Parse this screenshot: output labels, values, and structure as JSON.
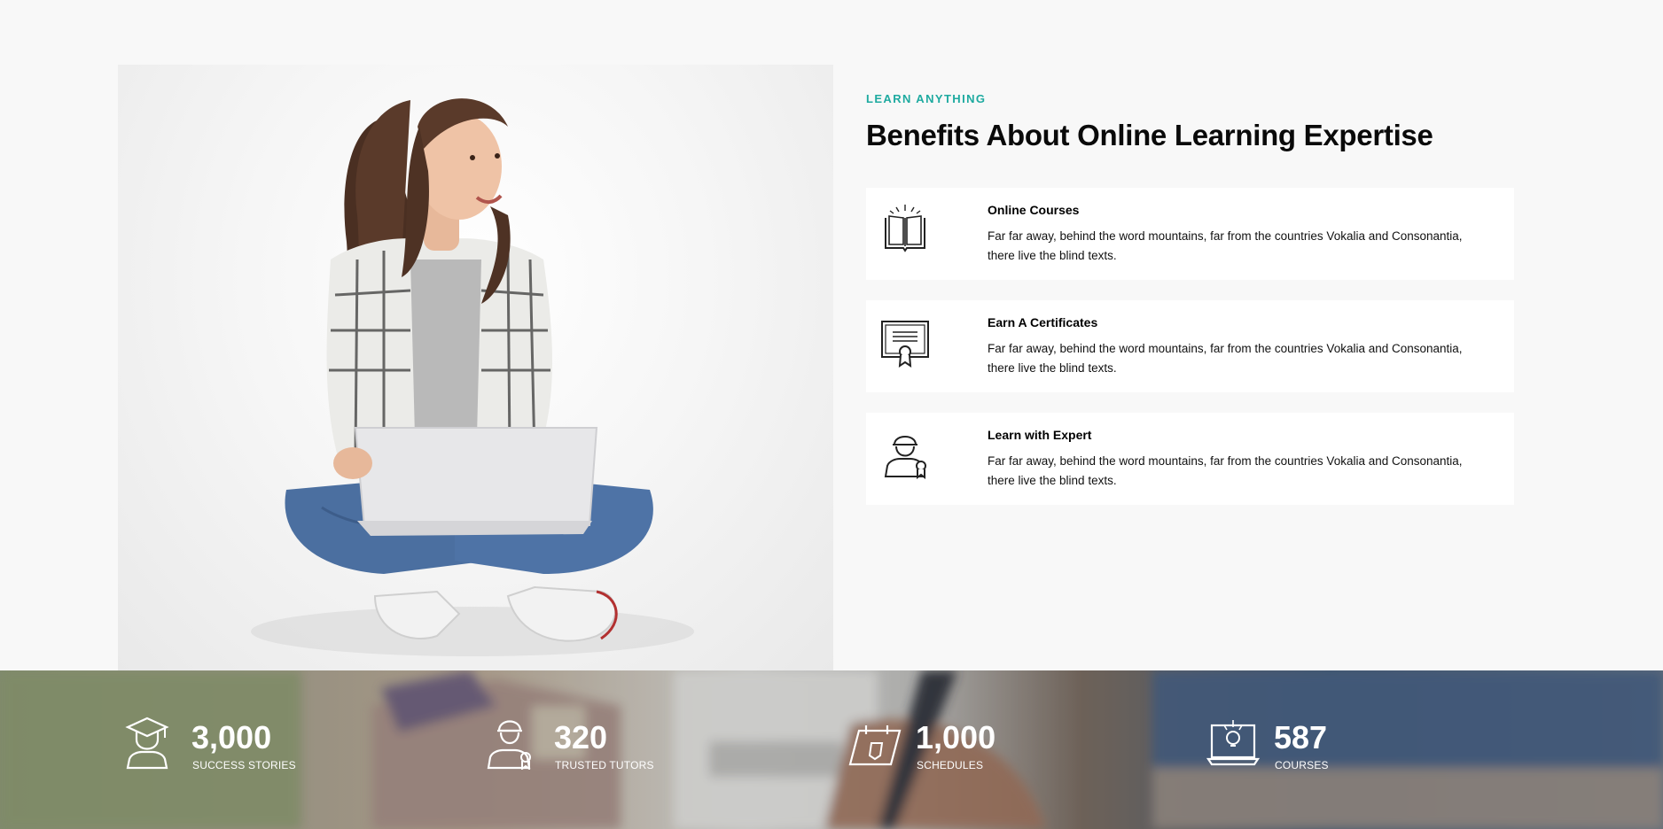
{
  "section": {
    "subheading": "LEARN ANYTHING",
    "heading": "Benefits About Online Learning Expertise"
  },
  "features": [
    {
      "icon": "open-book-icon",
      "title": "Online Courses",
      "description": "Far far away, behind the word mountains, far from the countries Vokalia and Consonantia, there live the blind texts."
    },
    {
      "icon": "certificate-icon",
      "title": "Earn A Certificates",
      "description": "Far far away, behind the word mountains, far from the countries Vokalia and Consonantia, there live the blind texts."
    },
    {
      "icon": "expert-tutor-icon",
      "title": "Learn with Expert",
      "description": "Far far away, behind the word mountains, far from the countries Vokalia and Consonantia, there live the blind texts."
    }
  ],
  "stats": [
    {
      "icon": "graduate-icon",
      "number": "3,000",
      "label": "SUCCESS STORIES"
    },
    {
      "icon": "tutor-icon",
      "number": "320",
      "label": "TRUSTED TUTORS"
    },
    {
      "icon": "calendar-icon",
      "number": "1,000",
      "label": "SCHEDULES"
    },
    {
      "icon": "laptop-idea-icon",
      "number": "587",
      "label": "COURSES"
    }
  ],
  "colors": {
    "accent": "#1eaaa0",
    "page_background": "#f8f8f8",
    "card_background": "#ffffff"
  }
}
